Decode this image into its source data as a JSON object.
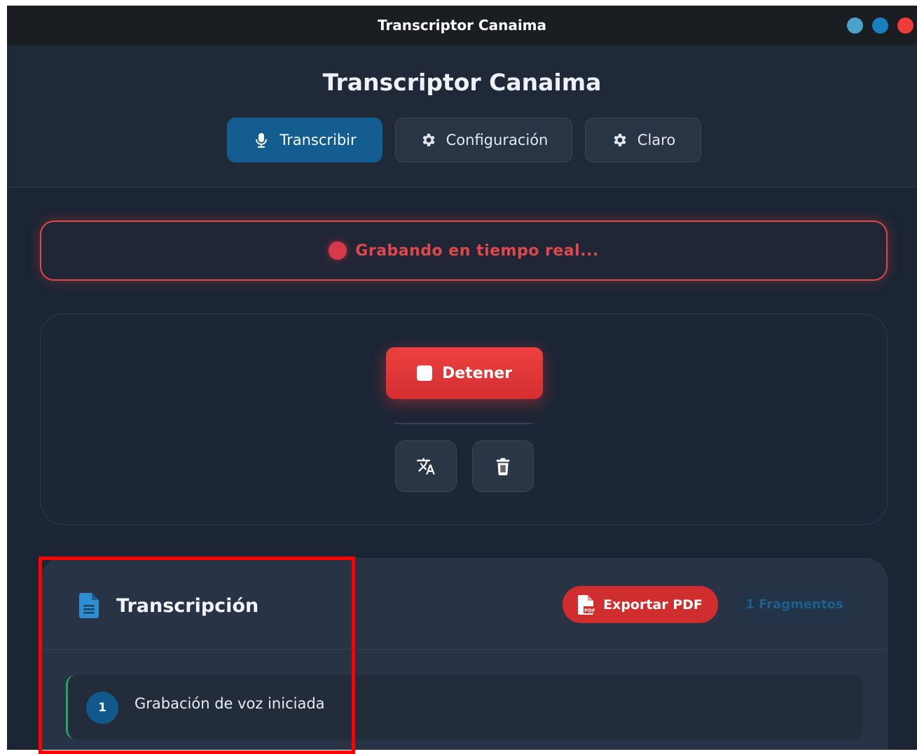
{
  "window": {
    "title": "Transcriptor Canaima",
    "controls": [
      {
        "name": "minimize",
        "color": "#4aa3c8"
      },
      {
        "name": "maximize",
        "color": "#1a7fc1"
      },
      {
        "name": "close",
        "color": "#f03b3b"
      }
    ]
  },
  "header": {
    "app_title": "Transcriptor Canaima",
    "tabs": [
      {
        "label": "Transcribir",
        "icon": "microphone-icon",
        "active": true
      },
      {
        "label": "Configuración",
        "icon": "gear-icon",
        "active": false
      },
      {
        "label": "Claro",
        "icon": "gear-icon",
        "active": false
      }
    ]
  },
  "status": {
    "text": "Grabando en tiempo real...",
    "color": "#e0474b"
  },
  "controls": {
    "stop_label": "Detener",
    "translate_icon": "translate-icon",
    "delete_icon": "trash-icon"
  },
  "transcription": {
    "title": "Transcripción",
    "export_label": "Exportar PDF",
    "fragments_label": "1 Fragmentos",
    "entries": [
      {
        "number": "1",
        "text": "Grabación de voz iniciada"
      }
    ]
  },
  "colors": {
    "accent": "#135d91",
    "danger": "#d52f31",
    "background": "#1b2534"
  }
}
